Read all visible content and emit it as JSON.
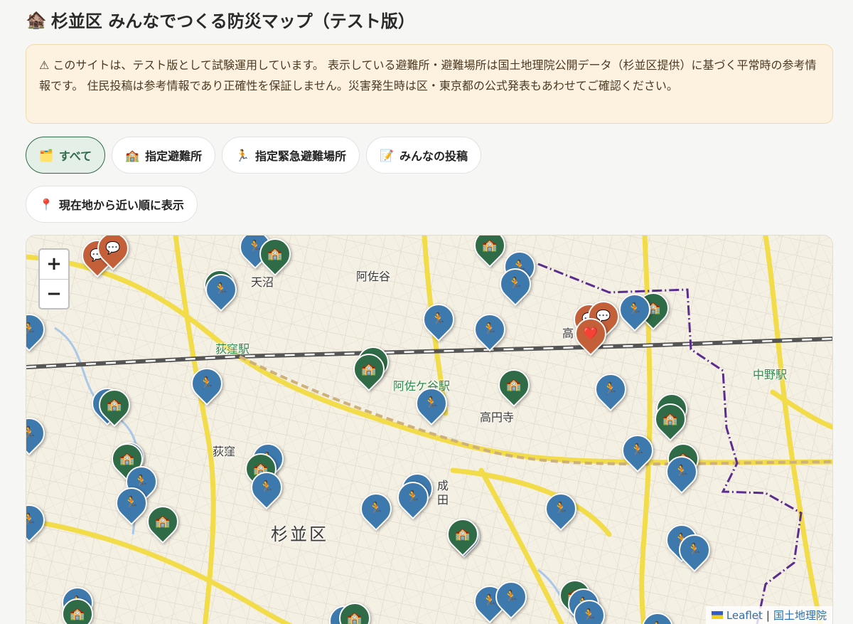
{
  "header": {
    "icon": "🏚️",
    "title": "杉並区 みんなでつくる防災マップ（テスト版）"
  },
  "notice": {
    "text": "⚠ このサイトは、テスト版として試験運用しています。 表示している避難所・避難場所は国土地理院公開データ（杉並区提供）に基づく平常時の参考情報です。 住民投稿は参考情報であり正確性を保証しません。災害発生時は区・東京都の公式発表もあわせてご確認ください。"
  },
  "filters": [
    {
      "icon": "🗂️",
      "label": "すべて",
      "active": true
    },
    {
      "icon": "🏫",
      "label": "指定避難所",
      "active": false
    },
    {
      "icon": "🏃",
      "label": "指定緊急避難場所",
      "active": false
    },
    {
      "icon": "📝",
      "label": "みんなの投稿",
      "active": false
    }
  ],
  "locate_button": {
    "icon": "📍",
    "label": "現在地から近い順に表示"
  },
  "map": {
    "zoom_in": "+",
    "zoom_out": "−",
    "labels": [
      "天沼",
      "阿佐谷",
      "荻窪駅",
      "阿佐ケ谷駅",
      "高円寺",
      "荻窪",
      "成田",
      "杉並区",
      "中野駅",
      "高"
    ],
    "attribution": {
      "leaflet": "Leaflet",
      "separator": "|",
      "source": "国土地理院"
    },
    "marker_icons": {
      "shelter": "🏫",
      "evacuation": "🏃",
      "post": "💬",
      "heart": "❤️"
    },
    "colors": {
      "shelter": "#2f6b47",
      "evacuation": "#3e79ad",
      "post": "#c3603a"
    }
  }
}
